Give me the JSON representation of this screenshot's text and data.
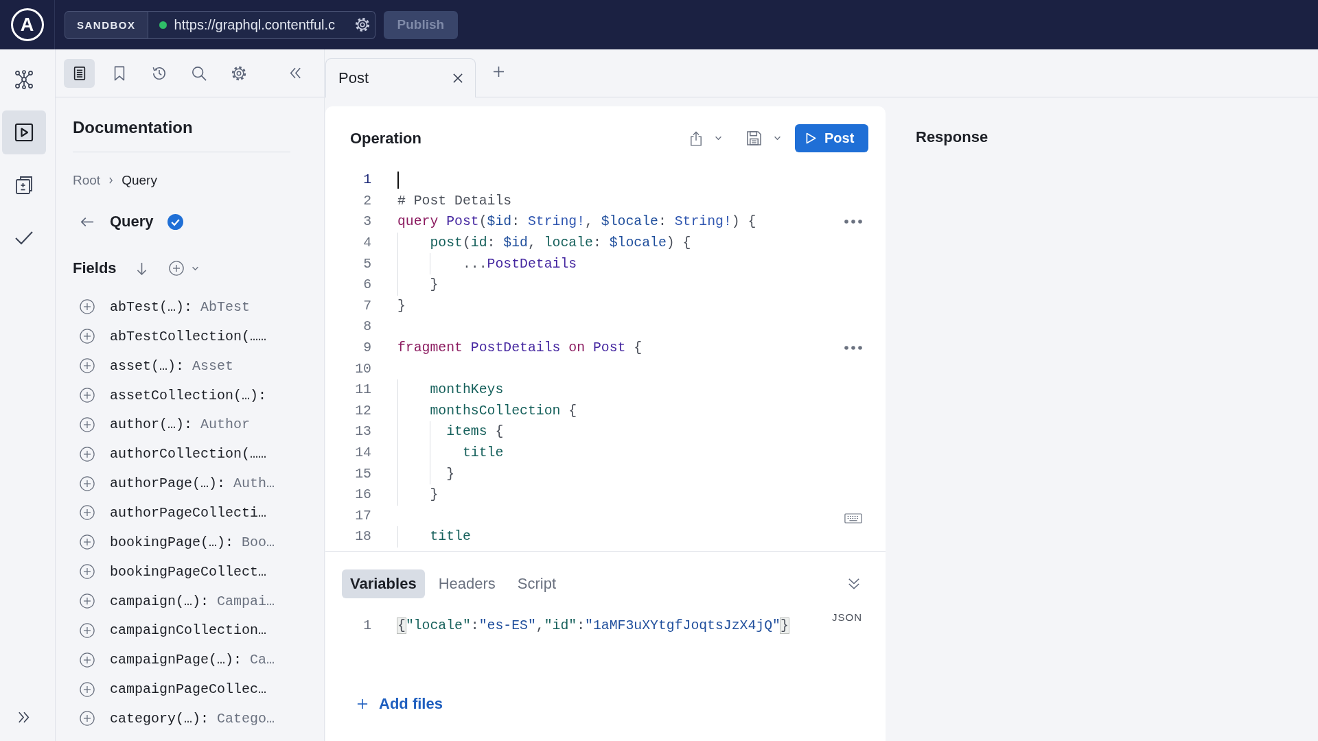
{
  "top_bar": {
    "logo_letter": "A",
    "environment": "SANDBOX",
    "connected": true,
    "url": "https://graphql.contentful.c",
    "publish": {
      "label": "Publish",
      "disabled": true
    }
  },
  "nav_rail": [
    {
      "kind": "schema",
      "selected": false
    },
    {
      "kind": "explorer",
      "selected": true
    },
    {
      "kind": "changes",
      "selected": false
    },
    {
      "kind": "checks",
      "selected": false
    }
  ],
  "doc_toolbar": [
    {
      "kind": "documentation",
      "selected": true
    },
    {
      "kind": "bookmarks",
      "selected": false
    },
    {
      "kind": "history",
      "selected": false
    },
    {
      "kind": "search",
      "selected": false
    },
    {
      "kind": "settings",
      "selected": false
    }
  ],
  "documentation": {
    "title": "Documentation",
    "breadcrumb": [
      {
        "label": "Root",
        "selected": false
      },
      {
        "label": "Query",
        "selected": true
      }
    ],
    "type_name": "Query",
    "fields_label": "Fields",
    "fields": [
      {
        "name": "abTest(…):",
        "type": "AbTest"
      },
      {
        "name": "abTestCollection(……"
      },
      {
        "name": "asset(…):",
        "type": "Asset"
      },
      {
        "name": "assetCollection(…):"
      },
      {
        "name": "author(…):",
        "type": "Author"
      },
      {
        "name": "authorCollection(……"
      },
      {
        "name": "authorPage(…):",
        "type": "Auth…"
      },
      {
        "name": "authorPageCollecti…"
      },
      {
        "name": "bookingPage(…):",
        "type": "Boo…"
      },
      {
        "name": "bookingPageCollect…"
      },
      {
        "name": "campaign(…):",
        "type": "Campai…"
      },
      {
        "name": "campaignCollection…"
      },
      {
        "name": "campaignPage(…):",
        "type": "Ca…"
      },
      {
        "name": "campaignPageCollec…"
      },
      {
        "name": "category(…):",
        "type": "Catego…"
      }
    ]
  },
  "tabs": [
    {
      "label": "Post",
      "selected": true
    }
  ],
  "operation": {
    "title": "Operation",
    "run_label": "Post",
    "lines": [
      {
        "number": "1",
        "active": true,
        "menu": false
      },
      {
        "number": "2",
        "active": false,
        "menu": false,
        "tokens": [
          {
            "text": "# Post Details",
            "kind": "comment"
          }
        ]
      },
      {
        "number": "3",
        "active": false,
        "menu": true,
        "tokens": [
          {
            "text": "query",
            "kind": "keyword"
          },
          {
            "text": " Post",
            "kind": "name"
          },
          {
            "text": "(",
            "kind": "punct"
          },
          {
            "text": "$id",
            "kind": "variable"
          },
          {
            "text": ": ",
            "kind": "punct"
          },
          {
            "text": "String!",
            "kind": "type"
          },
          {
            "text": ", ",
            "kind": "punct"
          },
          {
            "text": "$locale",
            "kind": "variable"
          },
          {
            "text": ": ",
            "kind": "punct"
          },
          {
            "text": "String!",
            "kind": "type"
          },
          {
            "text": ") {",
            "kind": "punct"
          }
        ]
      },
      {
        "number": "4",
        "active": false,
        "menu": false,
        "tokens": [
          {
            "text": "    post",
            "kind": "field"
          },
          {
            "text": "(",
            "kind": "punct"
          },
          {
            "text": "id",
            "kind": "field"
          },
          {
            "text": ": ",
            "kind": "punct"
          },
          {
            "text": "$id",
            "kind": "variable"
          },
          {
            "text": ", ",
            "kind": "punct"
          },
          {
            "text": "locale",
            "kind": "field"
          },
          {
            "text": ": ",
            "kind": "punct"
          },
          {
            "text": "$locale",
            "kind": "variable"
          },
          {
            "text": ") {",
            "kind": "punct"
          }
        ]
      },
      {
        "number": "5",
        "active": false,
        "menu": false,
        "tokens": [
          {
            "text": "        ...",
            "kind": "punct"
          },
          {
            "text": "PostDetails",
            "kind": "name"
          }
        ]
      },
      {
        "number": "6",
        "active": false,
        "menu": false,
        "tokens": [
          {
            "text": "    }",
            "kind": "punct"
          }
        ]
      },
      {
        "number": "7",
        "active": false,
        "menu": false,
        "tokens": [
          {
            "text": "}",
            "kind": "punct"
          }
        ]
      },
      {
        "number": "8",
        "active": false,
        "menu": false
      },
      {
        "number": "9",
        "active": false,
        "menu": true,
        "tokens": [
          {
            "text": "fragment",
            "kind": "keyword"
          },
          {
            "text": " PostDetails",
            "kind": "name"
          },
          {
            "text": " on",
            "kind": "keyword"
          },
          {
            "text": " Post",
            "kind": "name"
          },
          {
            "text": " {",
            "kind": "punct"
          }
        ]
      },
      {
        "number": "10",
        "active": false,
        "menu": false
      },
      {
        "number": "11",
        "active": false,
        "menu": false,
        "tokens": [
          {
            "text": "    monthKeys",
            "kind": "field"
          }
        ]
      },
      {
        "number": "12",
        "active": false,
        "menu": false,
        "tokens": [
          {
            "text": "    monthsCollection",
            "kind": "field"
          },
          {
            "text": " {",
            "kind": "punct"
          }
        ]
      },
      {
        "number": "13",
        "active": false,
        "menu": false,
        "tokens": [
          {
            "text": "      items",
            "kind": "field"
          },
          {
            "text": " {",
            "kind": "punct"
          }
        ]
      },
      {
        "number": "14",
        "active": false,
        "menu": false,
        "tokens": [
          {
            "text": "        title",
            "kind": "field"
          }
        ]
      },
      {
        "number": "15",
        "active": false,
        "menu": false,
        "tokens": [
          {
            "text": "      }",
            "kind": "punct"
          }
        ]
      },
      {
        "number": "16",
        "active": false,
        "menu": false,
        "tokens": [
          {
            "text": "    }",
            "kind": "punct"
          }
        ]
      },
      {
        "number": "17",
        "active": false,
        "menu": false
      },
      {
        "number": "18",
        "active": false,
        "menu": false,
        "tokens": [
          {
            "text": "    title",
            "kind": "field"
          }
        ]
      }
    ]
  },
  "variables_panel": {
    "tabs": [
      {
        "label": "Variables",
        "selected": true
      },
      {
        "label": "Headers",
        "selected": false
      },
      {
        "label": "Script",
        "selected": false
      }
    ],
    "format": "JSON",
    "lines": [
      {
        "number": "1",
        "tokens": [
          {
            "text": "{",
            "kind": "bracket"
          },
          {
            "text": "\"locale\"",
            "kind": "key"
          },
          {
            "text": ":",
            "kind": "punct"
          },
          {
            "text": "\"es-ES\"",
            "kind": "string"
          },
          {
            "text": ",",
            "kind": "punct"
          },
          {
            "text": "\"id\"",
            "kind": "key"
          },
          {
            "text": ":",
            "kind": "punct"
          },
          {
            "text": "\"1aMF3uXYtgfJoqtsJzX4jQ\"",
            "kind": "string"
          },
          {
            "text": "}",
            "kind": "bracket"
          }
        ]
      }
    ],
    "add_files": "Add files"
  },
  "response": {
    "title": "Response"
  }
}
